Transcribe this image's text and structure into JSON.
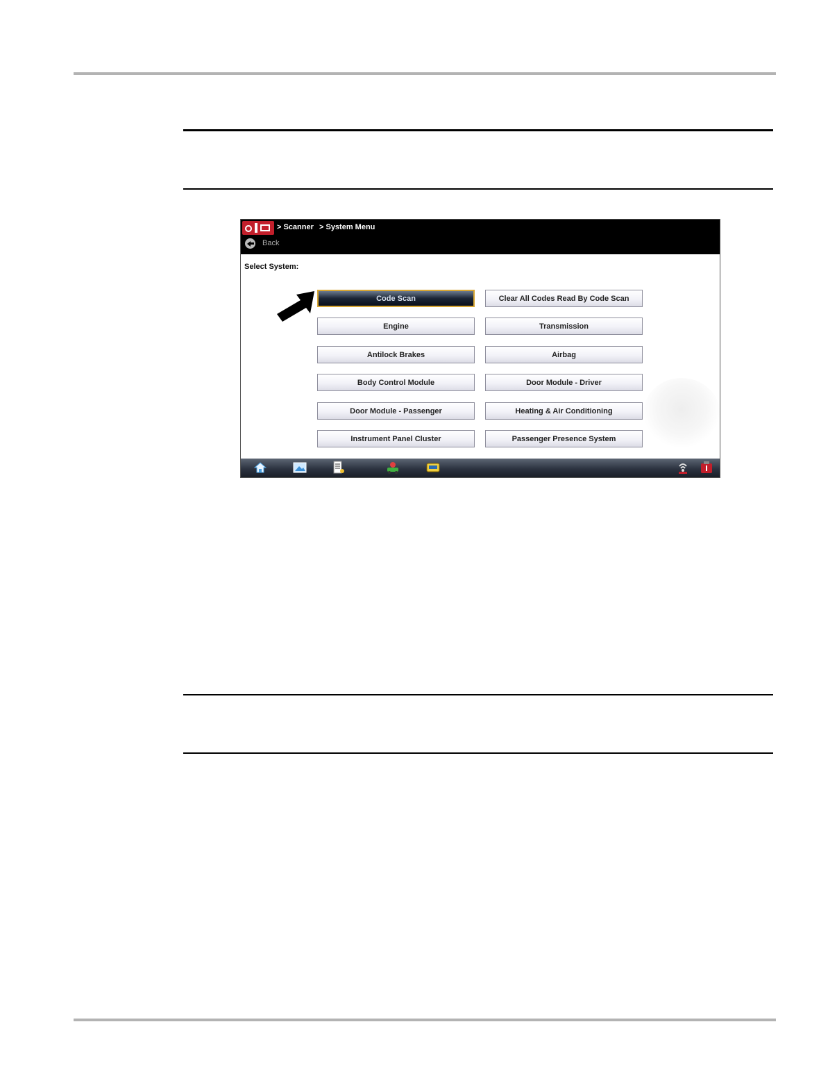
{
  "header": {
    "breadcrumb_scanner": "> Scanner",
    "breadcrumb_system_menu": "> System Menu",
    "back_label": "Back"
  },
  "prompt": "Select System:",
  "buttons": [
    {
      "label": "Code Scan",
      "selected": true
    },
    {
      "label": "Clear All Codes Read By Code Scan"
    },
    {
      "label": "Engine"
    },
    {
      "label": "Transmission"
    },
    {
      "label": "Antilock Brakes"
    },
    {
      "label": "Airbag"
    },
    {
      "label": "Body Control Module"
    },
    {
      "label": "Door Module - Driver"
    },
    {
      "label": "Door Module - Passenger"
    },
    {
      "label": "Heating & Air Conditioning"
    },
    {
      "label": "Instrument Panel Cluster"
    },
    {
      "label": "Passenger Presence System"
    }
  ],
  "taskbar": {
    "icons": [
      "home-icon",
      "screen-capture-icon",
      "data-list-icon",
      "vehicle-id-icon",
      "scanner-icon",
      "connection-icon",
      "power-icon"
    ]
  },
  "colors": {
    "titlebar": "#000000",
    "selected_border": "#d7a634",
    "logo": "#c21f2b"
  }
}
